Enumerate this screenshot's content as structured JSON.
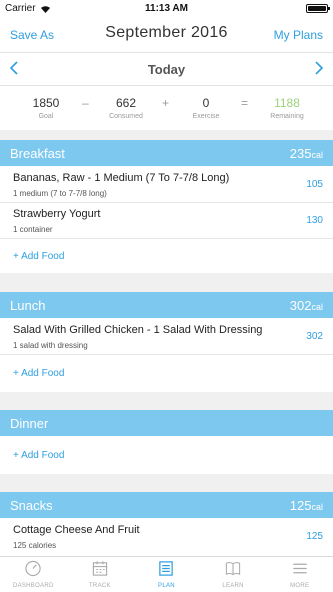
{
  "status": {
    "carrier": "Carrier",
    "time": "11:13 AM"
  },
  "header": {
    "save_label": "Save As",
    "title": "September 2016",
    "plans_label": "My Plans"
  },
  "date_nav": {
    "label": "Today"
  },
  "summary": {
    "goal": {
      "value": "1850",
      "label": "Goal"
    },
    "consumed": {
      "value": "662",
      "label": "Consumed"
    },
    "exercise": {
      "value": "0",
      "label": "Exercise"
    },
    "remaining": {
      "value": "1188",
      "label": "Remaining"
    },
    "ops": {
      "minus": "–",
      "plus": "+",
      "equals": "="
    }
  },
  "meals": {
    "breakfast": {
      "name": "Breakfast",
      "calories": "235",
      "unit": "cal",
      "items": [
        {
          "name": "Bananas, Raw - 1 Medium (7 To 7-7/8 Long)",
          "desc": "1 medium (7 to 7-7/8 long)",
          "cal": "105"
        },
        {
          "name": "Strawberry Yogurt",
          "desc": "1 container",
          "cal": "130"
        }
      ],
      "add_label": "+ Add Food"
    },
    "lunch": {
      "name": "Lunch",
      "calories": "302",
      "unit": "cal",
      "items": [
        {
          "name": "Salad With Grilled Chicken - 1 Salad With Dressing",
          "desc": "1 salad with dressing",
          "cal": "302"
        }
      ],
      "add_label": "+ Add Food"
    },
    "dinner": {
      "name": "Dinner",
      "add_label": "+ Add Food"
    },
    "snacks": {
      "name": "Snacks",
      "calories": "125",
      "unit": "cal",
      "items": [
        {
          "name": "Cottage Cheese And Fruit",
          "desc": "125 calories",
          "cal": "125"
        }
      ]
    }
  },
  "tabs": [
    {
      "label": "DASHBOARD",
      "icon": "dashboard-icon"
    },
    {
      "label": "TRACK",
      "icon": "calendar-icon"
    },
    {
      "label": "PLAN",
      "icon": "plan-icon"
    },
    {
      "label": "LEARN",
      "icon": "book-icon"
    },
    {
      "label": "MORE",
      "icon": "menu-icon"
    }
  ],
  "colors": {
    "accent": "#2f9fe0",
    "section": "#7cc8ef",
    "remaining": "#9bd37a"
  }
}
